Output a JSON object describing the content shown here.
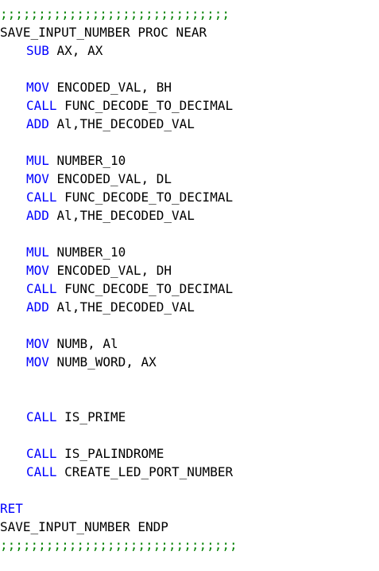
{
  "code": {
    "comment_top": ";;;;;;;;;;;;;;;;;;;;;;;;;;;;;;",
    "comment_bottom": ";;;;;;;;;;;;;;;;;;;;;;;;;;;;;;;",
    "proc_header": "SAVE_INPUT_NUMBER PROC NEAR",
    "proc_footer": "SAVE_INPUT_NUMBER ENDP",
    "lines": [
      {
        "kw": "SUB",
        "ops": " AX, AX"
      },
      {
        "kw": "MOV",
        "ops": " ENCODED_VAL, BH"
      },
      {
        "kw": "CALL",
        "ops": " FUNC_DECODE_TO_DECIMAL"
      },
      {
        "kw": "ADD",
        "ops": " Al,THE_DECODED_VAL"
      },
      {
        "kw": "MUL",
        "ops": " NUMBER_10"
      },
      {
        "kw": "MOV",
        "ops": " ENCODED_VAL, DL"
      },
      {
        "kw": "CALL",
        "ops": " FUNC_DECODE_TO_DECIMAL"
      },
      {
        "kw": "ADD",
        "ops": " Al,THE_DECODED_VAL"
      },
      {
        "kw": "MUL",
        "ops": " NUMBER_10"
      },
      {
        "kw": "MOV",
        "ops": " ENCODED_VAL, DH"
      },
      {
        "kw": "CALL",
        "ops": " FUNC_DECODE_TO_DECIMAL"
      },
      {
        "kw": "ADD",
        "ops": " Al,THE_DECODED_VAL"
      },
      {
        "kw": "MOV",
        "ops": " NUMB, Al"
      },
      {
        "kw": "MOV",
        "ops": " NUMB_WORD, AX"
      },
      {
        "kw": "CALL",
        "ops": " IS_PRIME"
      },
      {
        "kw": "CALL",
        "ops": " IS_PALINDROME"
      },
      {
        "kw": "CALL",
        "ops": " CREATE_LED_PORT_NUMBER"
      }
    ],
    "ret": "RET"
  },
  "colors": {
    "keyword": "#0000ff",
    "comment": "#008000",
    "text": "#000000",
    "background": "#ffffff"
  }
}
